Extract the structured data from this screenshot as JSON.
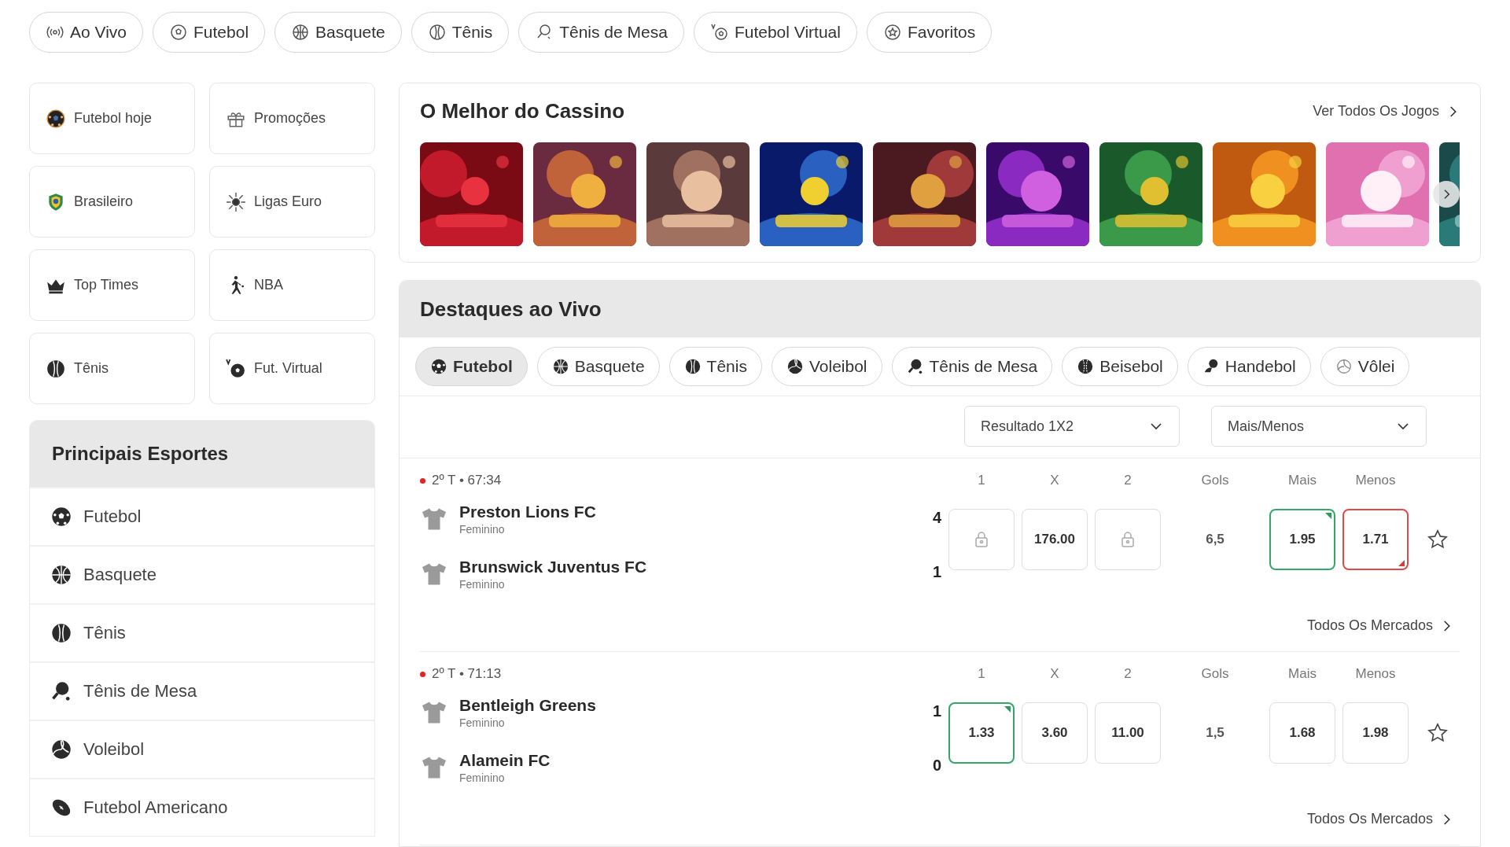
{
  "top_nav": [
    {
      "label": "Ao Vivo"
    },
    {
      "label": "Futebol"
    },
    {
      "label": "Basquete"
    },
    {
      "label": "Tênis"
    },
    {
      "label": "Tênis de Mesa"
    },
    {
      "label": "Futebol Virtual"
    },
    {
      "label": "Favoritos"
    }
  ],
  "quick_links": [
    {
      "label": "Futebol hoje"
    },
    {
      "label": "Promoções"
    },
    {
      "label": "Brasileiro"
    },
    {
      "label": "Ligas Euro"
    },
    {
      "label": "Top Times"
    },
    {
      "label": "NBA"
    },
    {
      "label": "Tênis"
    },
    {
      "label": "Fut. Virtual"
    }
  ],
  "main_sports": {
    "title": "Principais Esportes",
    "items": [
      {
        "label": "Futebol"
      },
      {
        "label": "Basquete"
      },
      {
        "label": "Tênis"
      },
      {
        "label": "Tênis de Mesa"
      },
      {
        "label": "Voleibol"
      },
      {
        "label": "Futebol Americano"
      }
    ]
  },
  "casino": {
    "title": "O Melhor do Cassino",
    "see_all": "Ver Todos Os Jogos"
  },
  "live": {
    "title": "Destaques ao Vivo",
    "tabs": [
      {
        "label": "Futebol",
        "selected": true
      },
      {
        "label": "Basquete",
        "selected": false
      },
      {
        "label": "Tênis",
        "selected": false
      },
      {
        "label": "Voleibol",
        "selected": false
      },
      {
        "label": "Tênis de Mesa",
        "selected": false
      },
      {
        "label": "Beisebol",
        "selected": false
      },
      {
        "label": "Handebol",
        "selected": false
      },
      {
        "label": "Vôlei",
        "selected": false
      }
    ],
    "dropdowns": [
      {
        "value": "Resultado 1X2"
      },
      {
        "value": "Mais/Menos"
      }
    ],
    "matches": [
      {
        "time": "2º T • 67:34",
        "live": true,
        "columns": [
          "1",
          "X",
          "2",
          "Gols",
          "Mais",
          "Menos"
        ],
        "teams": [
          {
            "name": "Preston Lions FC",
            "category": "Feminino",
            "score": "4"
          },
          {
            "name": "Brunswick Juventus FC",
            "category": "Feminino",
            "score": "1"
          }
        ],
        "odds": [
          {
            "locked": true,
            "rising": false,
            "falling": false
          },
          {
            "value": "176.00",
            "locked": false,
            "rising": false,
            "falling": false
          },
          {
            "locked": true,
            "rising": false,
            "falling": false
          }
        ],
        "goals": "6,5",
        "totals": [
          {
            "value": "1.95",
            "locked": false,
            "rising": true,
            "falling": false
          },
          {
            "value": "1.71",
            "locked": false,
            "rising": false,
            "falling": true
          }
        ],
        "favorite": false,
        "markets_link": "Todos Os Mercados"
      },
      {
        "time": "2º T • 71:13",
        "live": true,
        "columns": [
          "1",
          "X",
          "2",
          "Gols",
          "Mais",
          "Menos"
        ],
        "teams": [
          {
            "name": "Bentleigh Greens",
            "category": "Feminino",
            "score": "1"
          },
          {
            "name": "Alamein FC",
            "category": "Feminino",
            "score": "0"
          }
        ],
        "odds": [
          {
            "value": "1.33",
            "locked": false,
            "rising": true,
            "falling": false
          },
          {
            "value": "3.60",
            "locked": false,
            "rising": false,
            "falling": false
          },
          {
            "value": "11.00",
            "locked": false,
            "rising": false,
            "falling": false
          }
        ],
        "goals": "1,5",
        "totals": [
          {
            "value": "1.68",
            "locked": false,
            "rising": false,
            "falling": false
          },
          {
            "value": "1.98",
            "locked": false,
            "rising": false,
            "falling": false
          }
        ],
        "favorite": false,
        "markets_link": "Todos Os Mercados"
      }
    ]
  }
}
